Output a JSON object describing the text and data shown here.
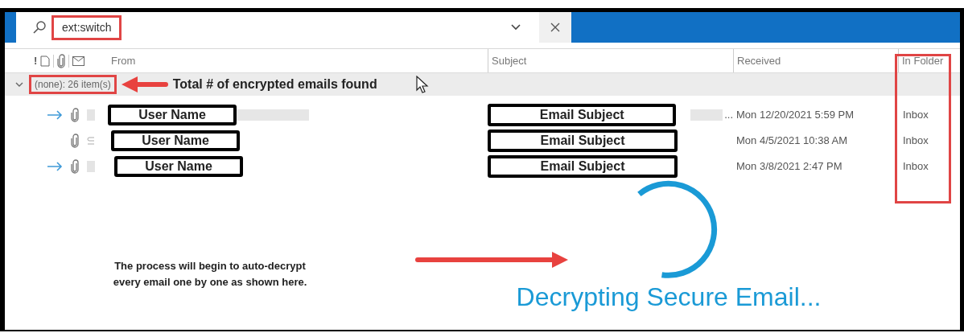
{
  "search": {
    "value": "ext:switch"
  },
  "header": {
    "importance_mark": "!",
    "columns": [
      {
        "label": "From"
      },
      {
        "label": "Subject"
      },
      {
        "label": "Received"
      },
      {
        "label": "In Folder"
      }
    ]
  },
  "group": {
    "label": "(none): 26 item(s)",
    "expanded": true,
    "note": "Total # of encrypted emails found"
  },
  "messages": [
    {
      "forwarded": true,
      "envelope": false,
      "from": "User Name",
      "subject": "Email Subject",
      "subject_overflow": "...",
      "received": "Mon 12/20/2021 5:59 PM",
      "folder": "Inbox"
    },
    {
      "forwarded": false,
      "envelope": true,
      "from": "User Name",
      "subject": "Email Subject",
      "received": "Mon 4/5/2021 10:38 AM",
      "folder": "Inbox"
    },
    {
      "forwarded": true,
      "envelope": false,
      "from": "User Name",
      "subject": "Email Subject",
      "received": "Mon 3/8/2021 2:47 PM",
      "folder": "Inbox"
    }
  ],
  "process_note": "The process will begin to auto-decrypt every email one by one as shown here.",
  "status": {
    "label": "Decrypting Secure Email..."
  }
}
